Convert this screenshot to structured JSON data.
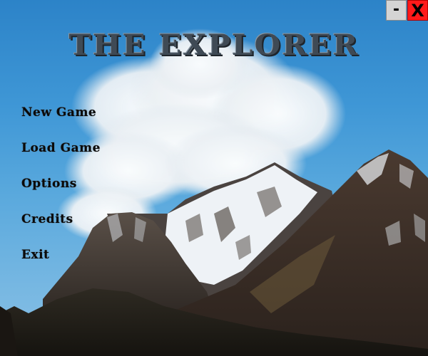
{
  "title": "THE EXPLORER",
  "menu": {
    "new_game": "New Game",
    "load_game": "Load Game",
    "options": "Options",
    "credits": "Credits",
    "exit": "Exit"
  },
  "window": {
    "minimize_label": "-",
    "close_label": "X"
  },
  "colors": {
    "sky": "#3f97d6",
    "title": "#3f4a55",
    "close_button": "#ff1a1a",
    "minimize_button": "#d4d4d4"
  }
}
